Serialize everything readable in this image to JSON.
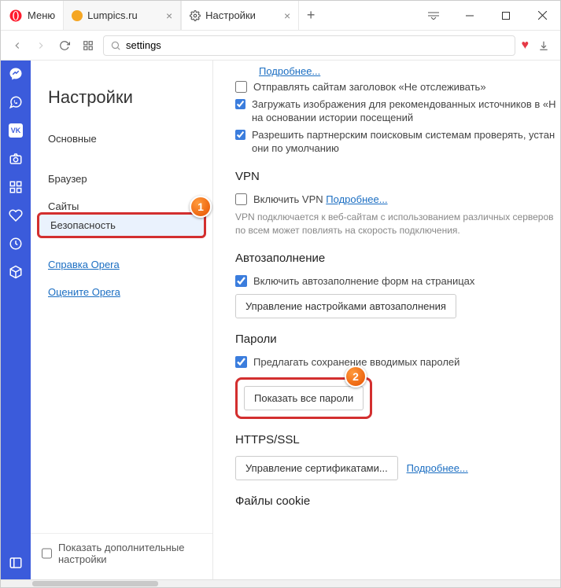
{
  "menu_label": "Меню",
  "tabs": [
    {
      "label": "Lumpics.ru",
      "icon_color": "#f5a623"
    },
    {
      "label": "Настройки",
      "icon": "gear"
    }
  ],
  "address": "settings",
  "sidebar": {
    "title": "Настройки",
    "items": [
      {
        "label": "Основные"
      },
      {
        "label": "Браузер"
      },
      {
        "label": "Сайты",
        "partial": true
      },
      {
        "label": "Безопасность",
        "active": true
      },
      {
        "label": "Справка Opera",
        "link": true
      },
      {
        "label": "Оцените Opera",
        "link": true
      }
    ],
    "advanced_label": "Показать дополнительные настройки"
  },
  "top_rows": {
    "more": "Подробнее...",
    "dnt": "Отправлять сайтам заголовок «Не отслеживать»",
    "images": "Загружать изображения для рекомендованных источников в «Н на основании истории посещений",
    "partner": "Разрешить партнерским поисковым системам проверять, устан они по умолчанию"
  },
  "vpn": {
    "title": "VPN",
    "enable": "Включить VPN",
    "more": "Подробнее...",
    "hint": "VPN подключается к веб-сайтам с использованием различных серверов по всем может повлиять на скорость подключения."
  },
  "autofill": {
    "title": "Автозаполнение",
    "enable": "Включить автозаполнение форм на страницах",
    "manage": "Управление настройками автозаполнения"
  },
  "passwords": {
    "title": "Пароли",
    "offer": "Предлагать сохранение вводимых паролей",
    "show_all": "Показать все пароли"
  },
  "https": {
    "title": "HTTPS/SSL",
    "manage": "Управление сертификатами...",
    "more": "Подробнее..."
  },
  "cookies": {
    "title": "Файлы cookie"
  },
  "badges": {
    "one": "1",
    "two": "2"
  }
}
